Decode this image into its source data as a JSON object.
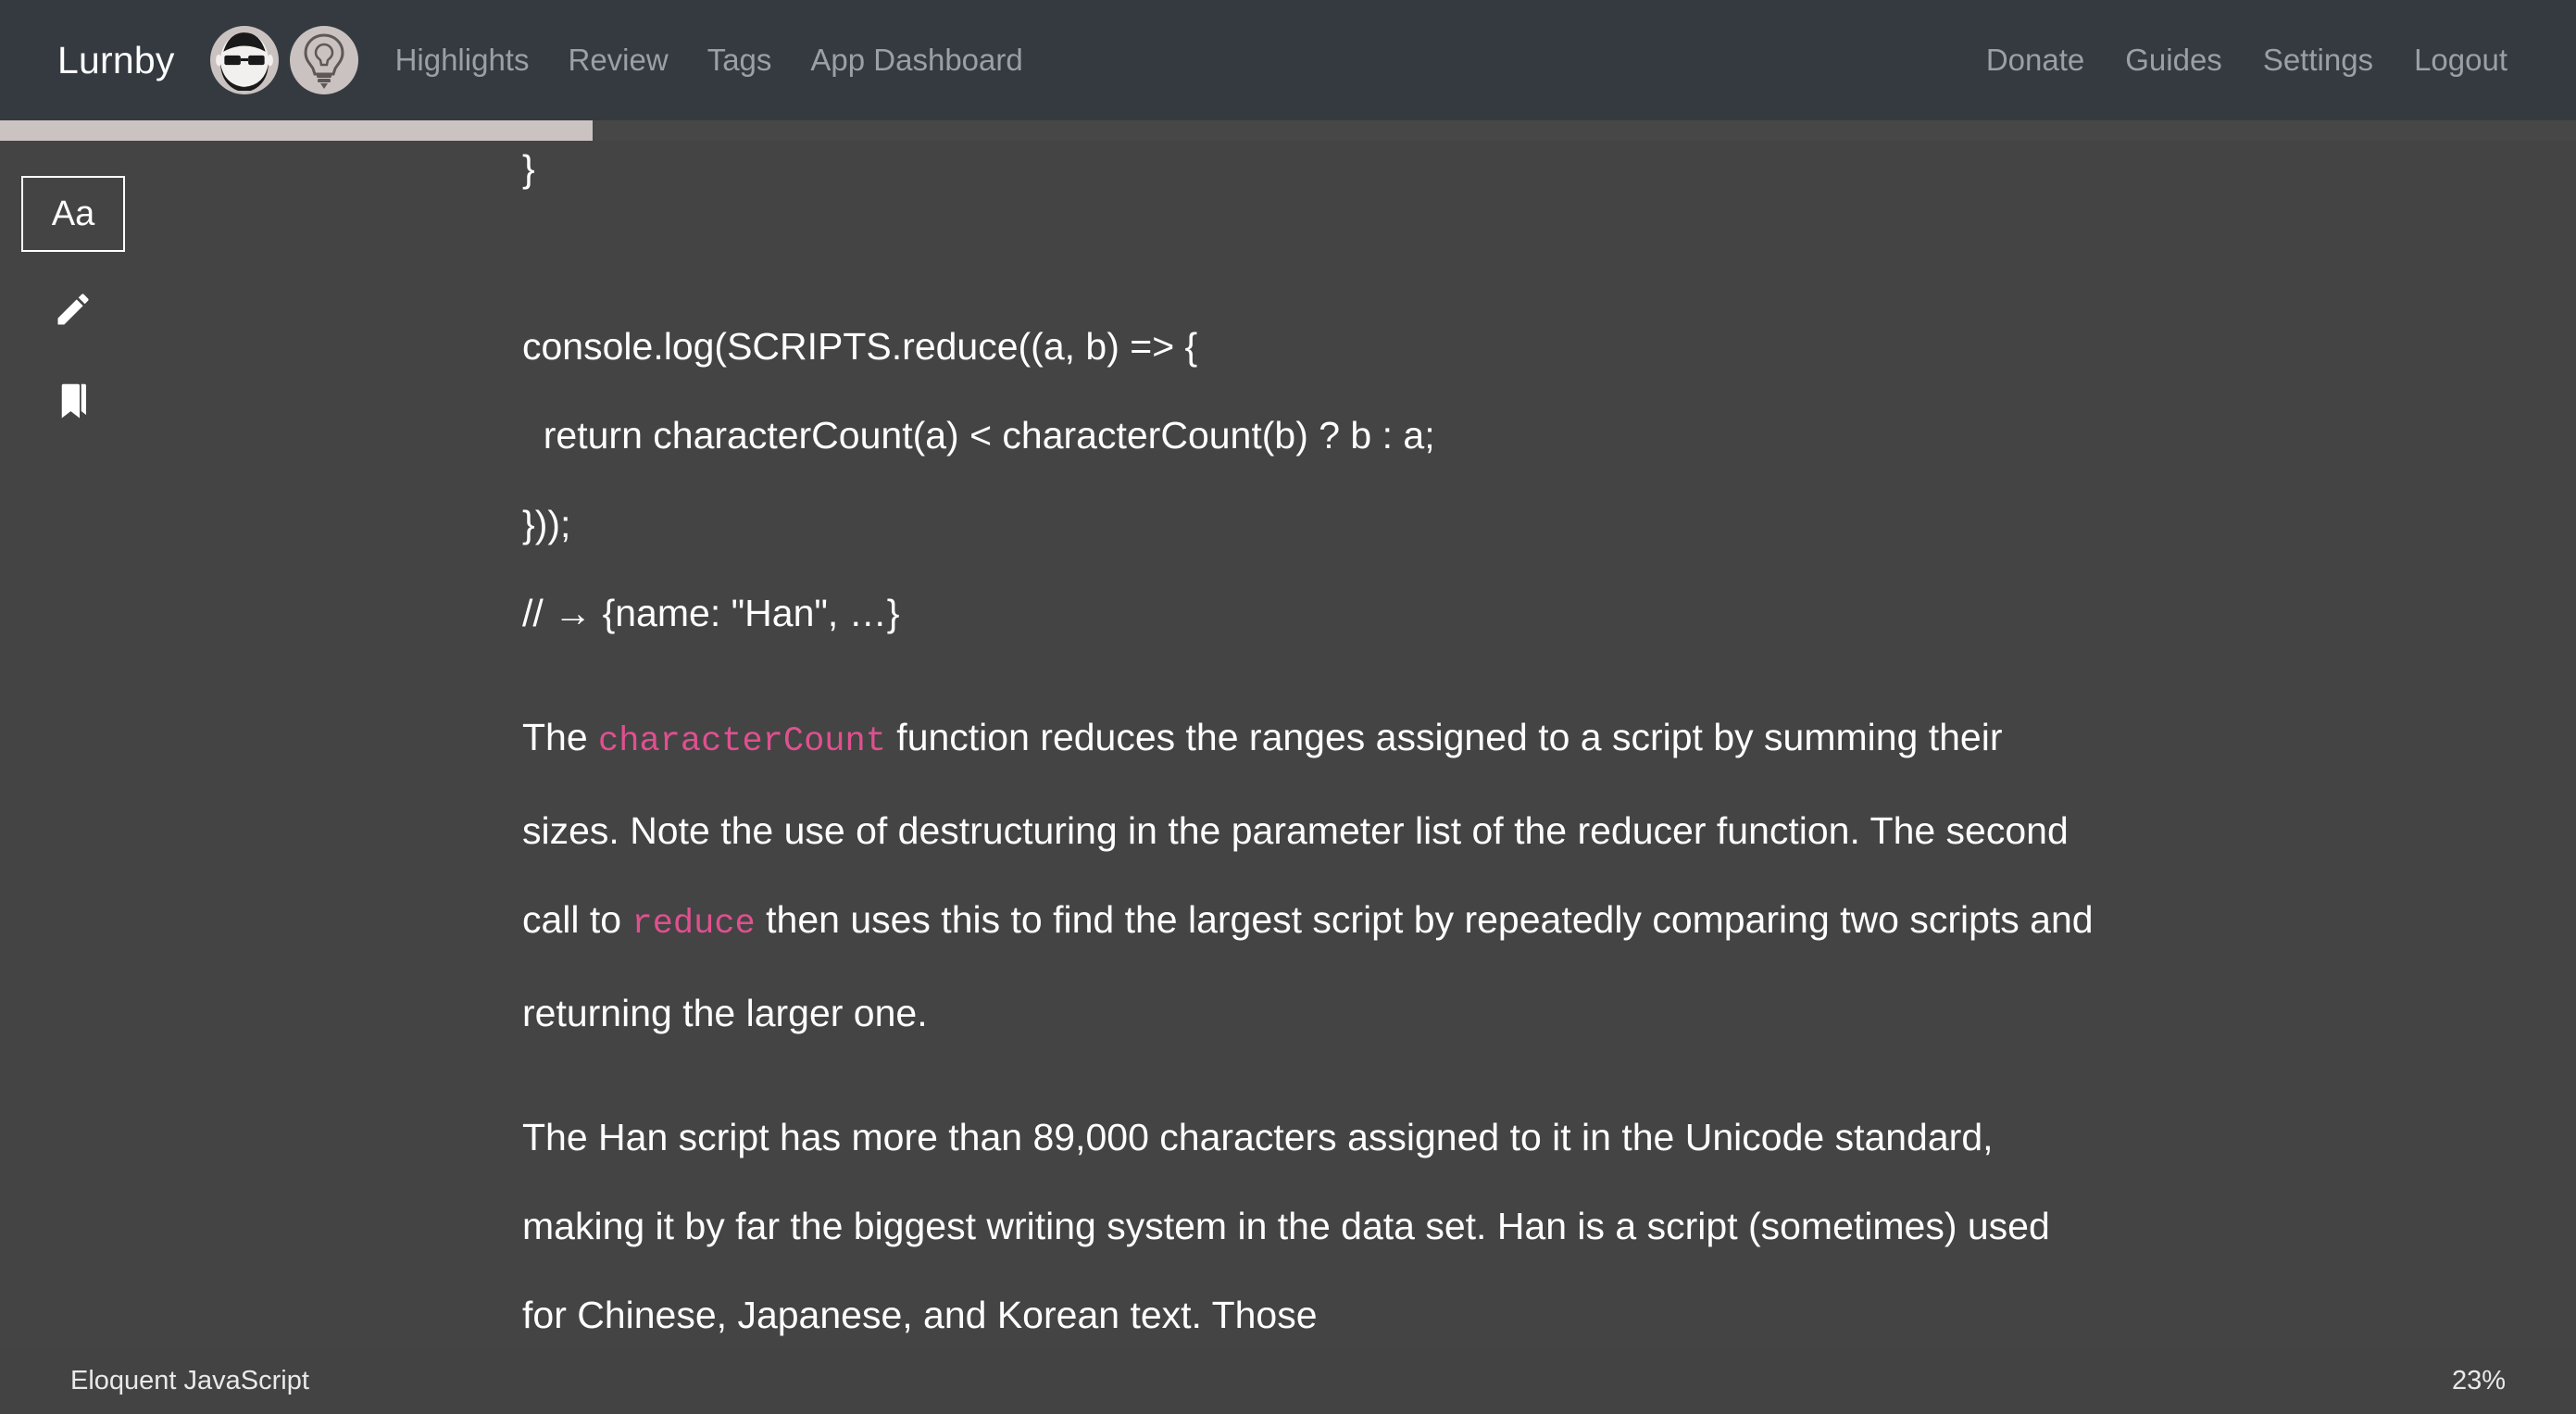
{
  "app": {
    "brand": "Lurnby",
    "accent_pink": "#e0508f",
    "navbar_bg": "#343a40",
    "content_bg": "#444444",
    "progress_fill_color": "#cbc3c2"
  },
  "navbar": {
    "avatars": [
      {
        "name": "user-avatar",
        "icon": "face-head-icon"
      },
      {
        "name": "lightbulb-avatar",
        "icon": "lightbulb-icon"
      }
    ],
    "left_links": [
      {
        "label": "Highlights",
        "name": "nav-link-highlights"
      },
      {
        "label": "Review",
        "name": "nav-link-review"
      },
      {
        "label": "Tags",
        "name": "nav-link-tags"
      },
      {
        "label": "App Dashboard",
        "name": "nav-link-app-dashboard"
      }
    ],
    "right_links": [
      {
        "label": "Donate",
        "name": "nav-link-donate"
      },
      {
        "label": "Guides",
        "name": "nav-link-guides"
      },
      {
        "label": "Settings",
        "name": "nav-link-settings"
      },
      {
        "label": "Logout",
        "name": "nav-link-logout"
      }
    ]
  },
  "progress": {
    "percent": 23,
    "percent_label": "23%",
    "fill_width": "23%"
  },
  "sidebar": {
    "font_size_label": "Aa",
    "tools": [
      {
        "name": "font-size-button",
        "label": "Aa"
      },
      {
        "name": "highlight-pencil-icon",
        "label": "Highlight"
      },
      {
        "name": "bookmark-icon",
        "label": "Bookmark"
      }
    ]
  },
  "reader": {
    "code_top": "}",
    "code_lines": [
      "console.log(SCRIPTS.reduce((a, b) => {",
      "  return characterCount(a) < characterCount(b) ? b : a;",
      "}));",
      "// → {name: \"Han\", …}"
    ],
    "paragraph1": {
      "part1": "The ",
      "code1": "characterCount",
      "part2": " function reduces the ranges assigned to a script by summing their sizes. Note the use of destructuring in the parameter list of the reducer function. The second call to ",
      "code2": "reduce",
      "part3": " then uses this to find the largest script by repeatedly comparing two scripts and returning the larger one."
    },
    "paragraph2": "The Han script has more than 89,000 characters assigned to it in the Unicode standard, making it by far the biggest writing system in the data set. Han is a script (sometimes) used for Chinese, Japanese, and Korean text. Those"
  },
  "footer": {
    "title": "Eloquent JavaScript",
    "percent": "23%"
  }
}
